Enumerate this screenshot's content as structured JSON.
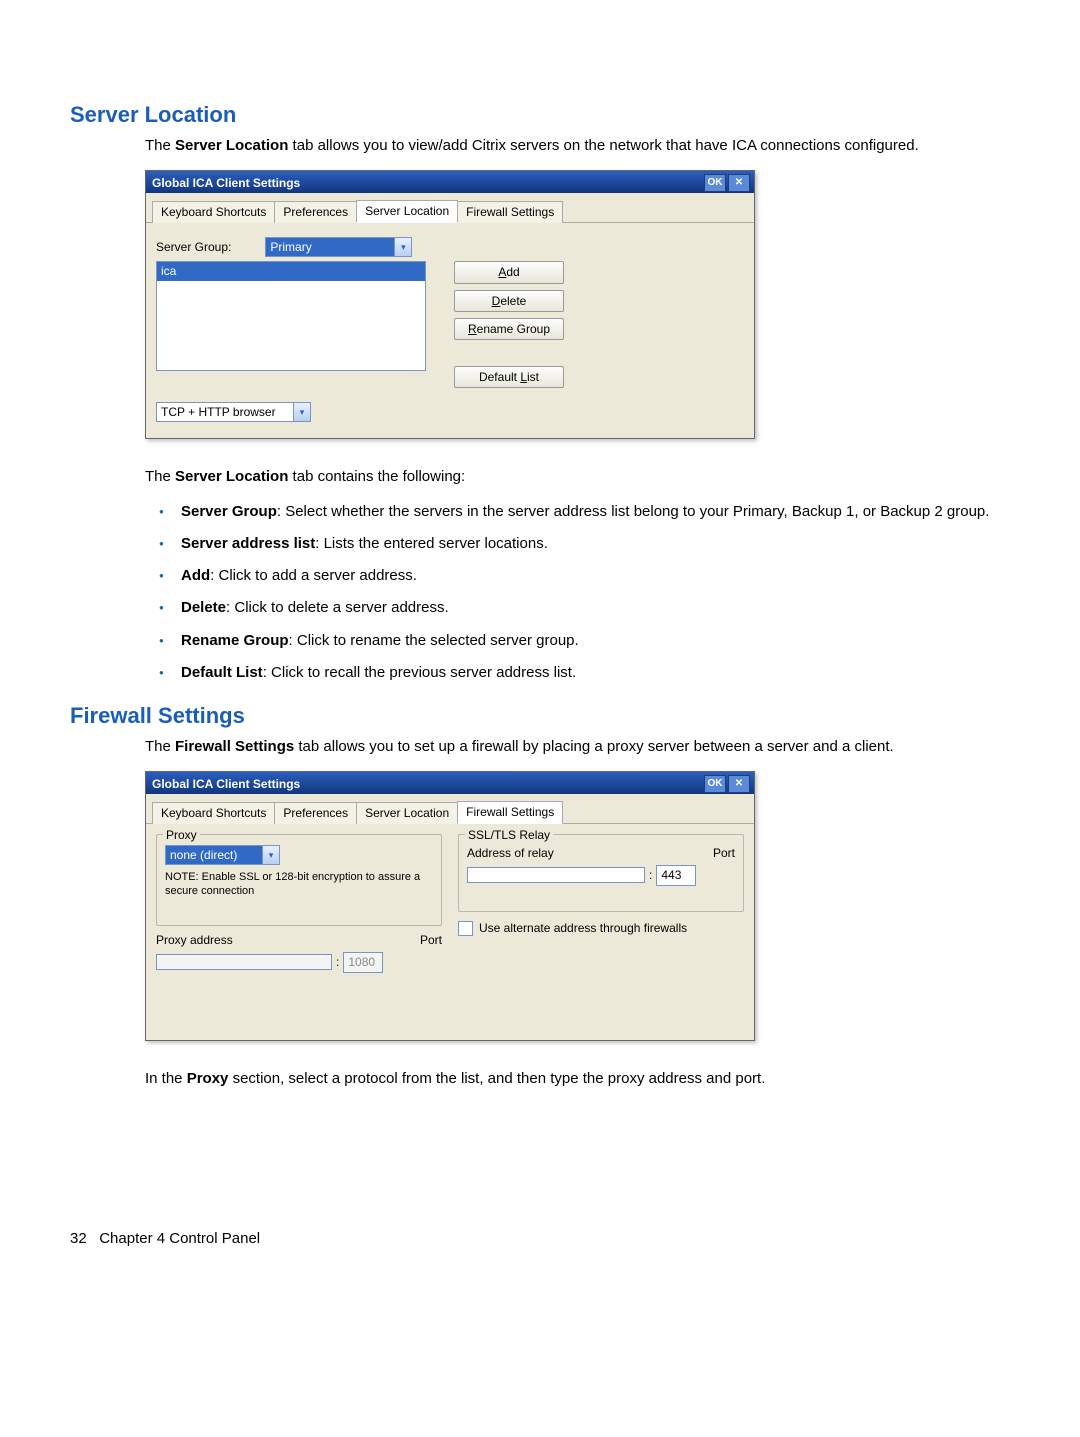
{
  "sections": {
    "serverLocation": {
      "heading": "Server Location",
      "intro_pre": "The ",
      "intro_bold": "Server Location",
      "intro_post": " tab allows you to view/add Citrix servers on the network that have ICA connections configured.",
      "listIntro_pre": "The ",
      "listIntro_bold": "Server Location",
      "listIntro_post": " tab contains the following:"
    },
    "firewall": {
      "heading": "Firewall Settings",
      "intro_pre": "The ",
      "intro_bold": "Firewall Settings",
      "intro_post": " tab allows you to set up a firewall by placing a proxy server between a server and a client.",
      "closing_pre": "In the ",
      "closing_bold": "Proxy",
      "closing_post": " section, select a protocol from the list, and then type the proxy address and port."
    }
  },
  "bullets": [
    {
      "b": "Server Group",
      "t": ": Select whether the servers in the server address list belong to your Primary, Backup 1, or Backup 2 group."
    },
    {
      "b": "Server address list",
      "t": ": Lists the entered server locations."
    },
    {
      "b": "Add",
      "t": ": Click to add a server address."
    },
    {
      "b": "Delete",
      "t": ": Click to delete a server address."
    },
    {
      "b": "Rename Group",
      "t": ": Click to rename the selected server group."
    },
    {
      "b": "Default List",
      "t": ": Click to recall the previous server address list."
    }
  ],
  "dialog": {
    "title": "Global ICA Client Settings",
    "ok": "OK",
    "close": "✕",
    "tabs": {
      "kb": "Keyboard Shortcuts",
      "pref": "Preferences",
      "sl": "Server Location",
      "fw": "Firewall Settings"
    }
  },
  "sl": {
    "serverGroupLabel": "Server Group:",
    "serverGroupValue": "Primary",
    "listItem": "ica",
    "browser": "TCP + HTTP browser",
    "buttons": {
      "add_pre": "",
      "add_u": "A",
      "add_post": "dd",
      "del_pre": "",
      "del_u": "D",
      "del_post": "elete",
      "ren_pre": "",
      "ren_u": "R",
      "ren_post": "ename Group",
      "def_pre": "Default ",
      "def_u": "L",
      "def_post": "ist"
    }
  },
  "fw": {
    "proxyLegend": "Proxy",
    "proxyValue": "none (direct)",
    "note": "NOTE: Enable SSL or 128-bit encryption to assure a secure connection",
    "proxyAddress": "Proxy address",
    "port": "Port",
    "portColon": ":",
    "proxyPort": "1080",
    "relayLegend": "SSL/TLS Relay",
    "relayAddress": "Address of relay",
    "relayPort": "443",
    "altAddr": "Use alternate address through firewalls"
  },
  "footer": {
    "page": "32",
    "chapter": "Chapter 4   Control Panel"
  }
}
